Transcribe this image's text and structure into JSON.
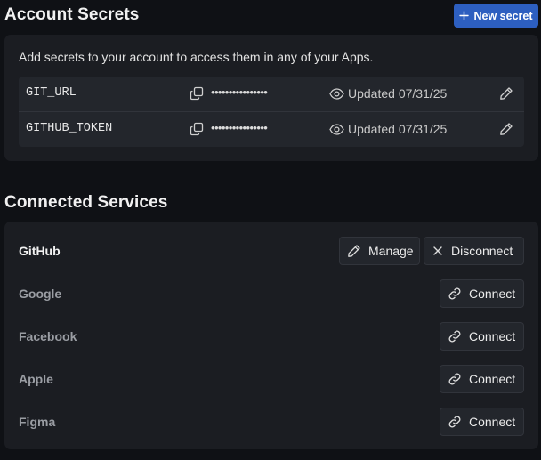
{
  "account_secrets": {
    "title": "Account Secrets",
    "new_secret_label": "New secret",
    "description": "Add secrets to your account to access them in any of your Apps.",
    "secrets": [
      {
        "name": "GIT_URL",
        "masked_value": "••••••••••••••••",
        "updated": "Updated 07/31/25"
      },
      {
        "name": "GITHUB_TOKEN",
        "masked_value": "••••••••••••••••",
        "updated": "Updated 07/31/25"
      }
    ]
  },
  "connected_services": {
    "title": "Connected Services",
    "services": [
      {
        "name": "GitHub",
        "connected": true,
        "manage_label": "Manage",
        "disconnect_label": "Disconnect"
      },
      {
        "name": "Google",
        "connected": false,
        "connect_label": "Connect"
      },
      {
        "name": "Facebook",
        "connected": false,
        "connect_label": "Connect"
      },
      {
        "name": "Apple",
        "connected": false,
        "connect_label": "Connect"
      },
      {
        "name": "Figma",
        "connected": false,
        "connect_label": "Connect"
      }
    ]
  },
  "colors": {
    "background": "#0f1115",
    "panel": "#1b1d22",
    "row": "#23262c",
    "accent": "#2d5fc0",
    "muted_text": "#9a9da3"
  },
  "icons": {
    "new_secret": "plus-icon",
    "copy": "copy-icon",
    "visibility": "eye-icon",
    "edit": "pencil-icon",
    "disconnect": "close-icon",
    "connect": "link-icon"
  }
}
